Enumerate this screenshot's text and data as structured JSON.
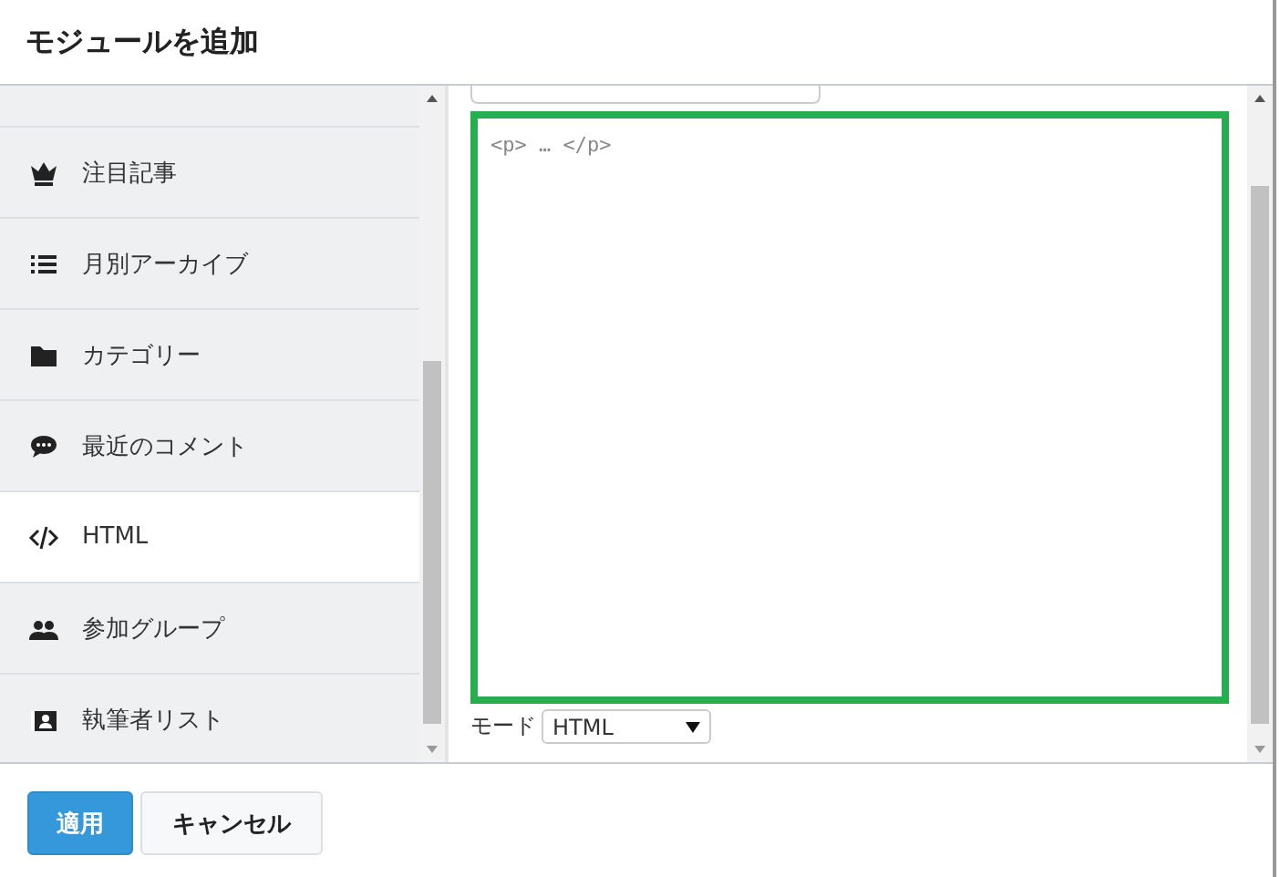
{
  "dialog": {
    "title": "モジュールを追加"
  },
  "module_list": {
    "items": [
      {
        "label": "注目記事",
        "selected": false
      },
      {
        "label": "月別アーカイブ",
        "selected": false
      },
      {
        "label": "カテゴリー",
        "selected": false
      },
      {
        "label": "最近のコメント",
        "selected": false
      },
      {
        "label": "HTML",
        "selected": true
      },
      {
        "label": "参加グループ",
        "selected": false
      },
      {
        "label": "執筆者リスト",
        "selected": false
      }
    ]
  },
  "editor": {
    "placeholder": "<p> … </p>",
    "mode_label": "モード",
    "mode_value": "HTML"
  },
  "buttons": [
    {
      "label": "適用",
      "kind": "primary"
    },
    {
      "label": "キャンセル",
      "kind": "secondary"
    }
  ]
}
